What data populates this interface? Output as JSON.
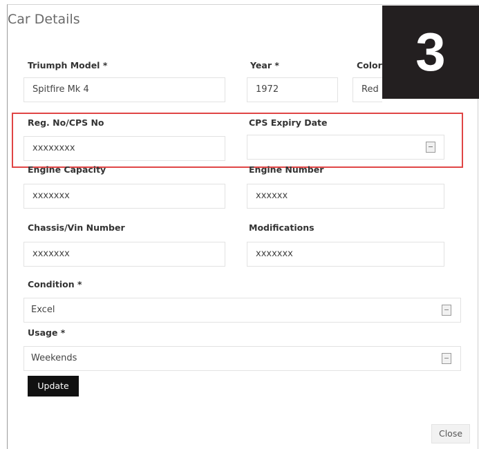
{
  "dialog": {
    "title": "Car Details",
    "step_number": "3",
    "fields": {
      "model": {
        "label": "Triumph Model *",
        "value": "Spitfire Mk 4"
      },
      "year": {
        "label": "Year *",
        "value": "1972"
      },
      "color": {
        "label": "Color",
        "value": "Red"
      },
      "reg_no": {
        "label": "Reg. No/CPS No",
        "value": "xxxxxxxx"
      },
      "cps_expiry": {
        "label": "CPS Expiry Date",
        "value": ""
      },
      "engine_capacity": {
        "label": "Engine Capacity",
        "value": "xxxxxxx"
      },
      "engine_number": {
        "label": "Engine Number",
        "value": "xxxxxx"
      },
      "chassis": {
        "label": "Chassis/Vin Number",
        "value": "xxxxxxx"
      },
      "modifications": {
        "label": "Modifications",
        "value": "xxxxxxx"
      },
      "condition": {
        "label": "Condition *",
        "value": "Excel"
      },
      "usage": {
        "label": "Usage *",
        "value": "Weekends"
      }
    },
    "update_label": "Update",
    "close_label": "Close",
    "highlight_color": "#e04545"
  }
}
